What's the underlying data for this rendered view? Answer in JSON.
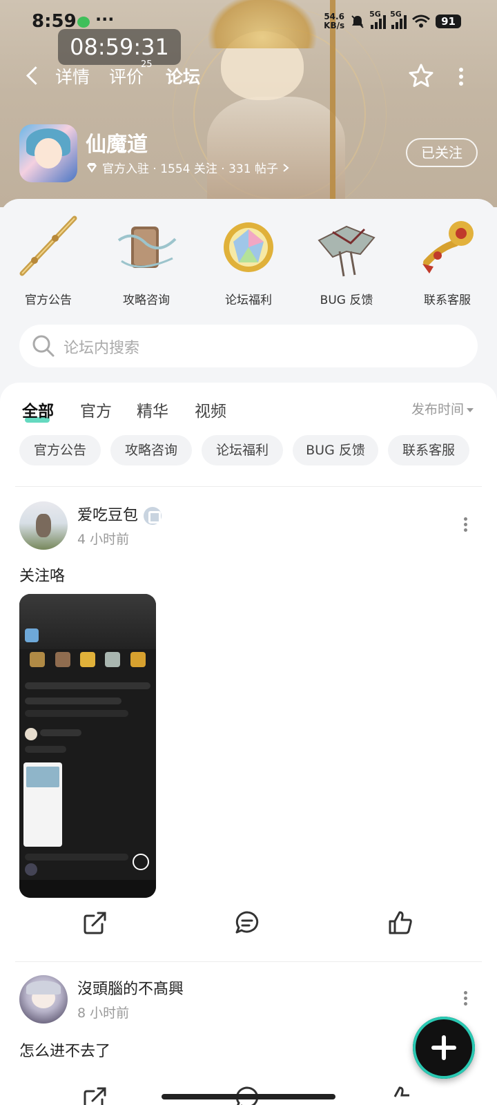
{
  "status_bar": {
    "time": "8:59",
    "dots": "···",
    "net_speed_value": "54.6",
    "net_speed_unit": "KB/s",
    "sim1": "5G",
    "sim2": "5G",
    "battery": "91"
  },
  "overlay_clock": "08:59:31",
  "nav": {
    "tabs": [
      {
        "label": "详情"
      },
      {
        "label": "评价",
        "badge": "25"
      },
      {
        "label": "论坛",
        "active": true
      }
    ]
  },
  "app": {
    "name": "仙魔道",
    "meta": "官方入驻 · 1554 关注 · 331 帖子",
    "follow_label": "已关注"
  },
  "categories": [
    {
      "label": "官方公告",
      "icon": "golden-staff-icon"
    },
    {
      "label": "攻略咨询",
      "icon": "scroll-drum-icon"
    },
    {
      "label": "论坛福利",
      "icon": "rainbow-gem-icon"
    },
    {
      "label": "BUG 反馈",
      "icon": "winged-artifact-icon"
    },
    {
      "label": "联系客服",
      "icon": "ruyi-scepter-icon"
    }
  ],
  "search": {
    "placeholder": "论坛内搜索"
  },
  "feed": {
    "tabs": [
      {
        "label": "全部",
        "active": true
      },
      {
        "label": "官方"
      },
      {
        "label": "精华"
      },
      {
        "label": "视频"
      }
    ],
    "sort_label": "发布时间",
    "chips": [
      "官方公告",
      "攻略咨询",
      "论坛福利",
      "BUG 反馈",
      "联系客服"
    ]
  },
  "posts": [
    {
      "author": "爱吃豆包",
      "time": "4 小时前",
      "text": "关注咯"
    },
    {
      "author": "沒頭腦的不髙興",
      "time": "8 小时前",
      "text": "怎么进不去了"
    }
  ],
  "colors": {
    "accent": "#3fd0b0",
    "hero": "#c4b6a3"
  }
}
